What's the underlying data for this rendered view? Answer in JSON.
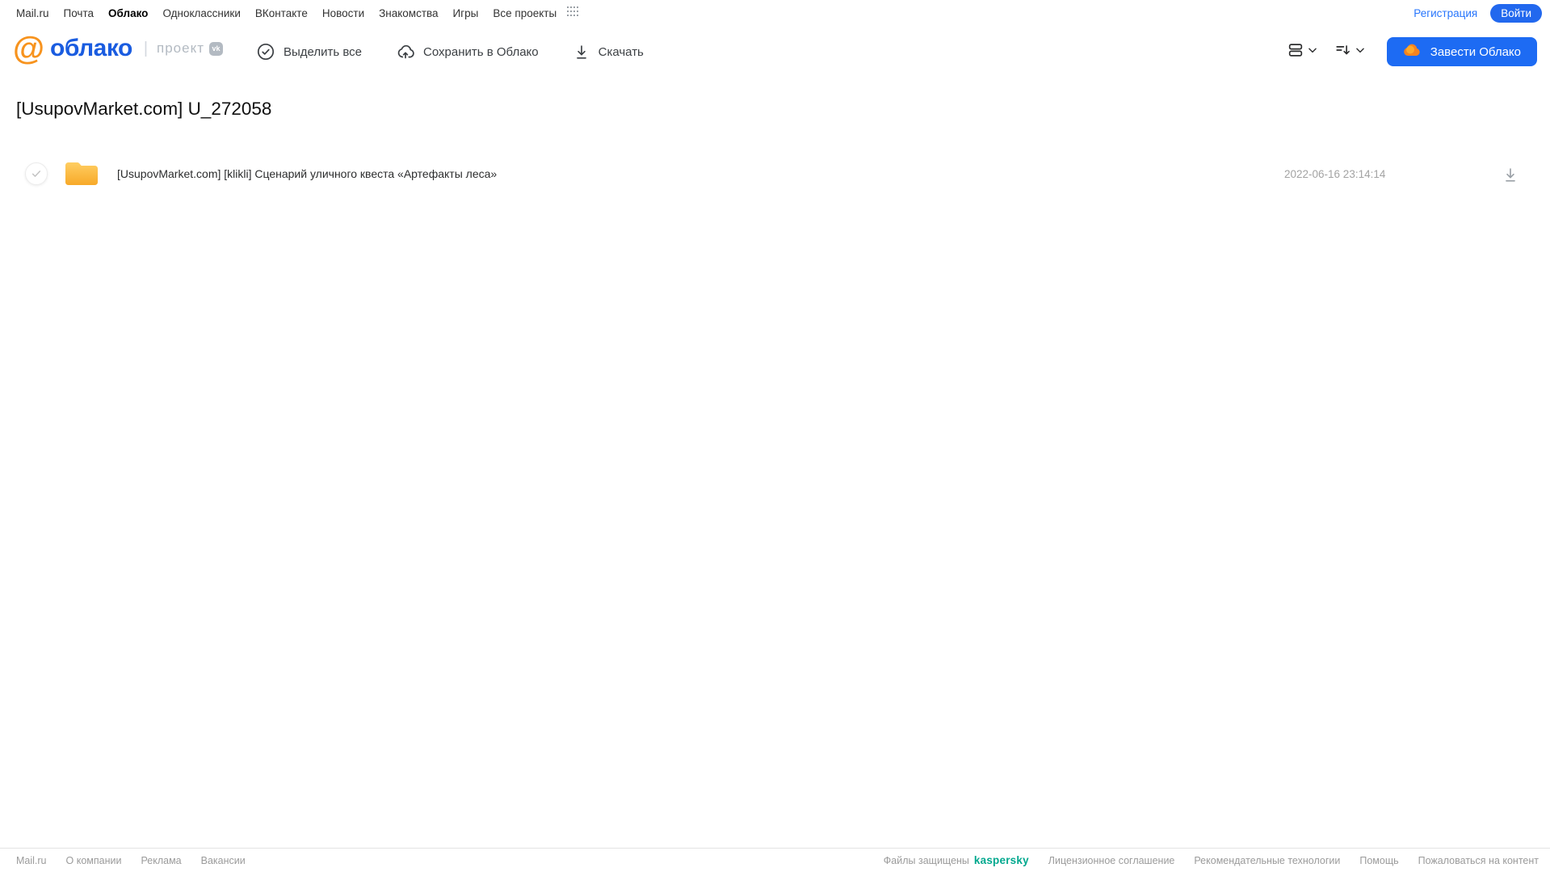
{
  "topnav": {
    "items": [
      "Mail.ru",
      "Почта",
      "Облако",
      "Одноклассники",
      "ВКонтакте",
      "Новости",
      "Знакомства",
      "Игры",
      "Все проекты"
    ],
    "registration": "Регистрация",
    "login": "Войти"
  },
  "brand": {
    "name": "облако",
    "at_sign": "@",
    "divider": "|",
    "project": "проект",
    "vk": "vk"
  },
  "toolbar": {
    "select_all": "Выделить все",
    "save_to_cloud": "Сохранить в Облако",
    "download": "Скачать"
  },
  "controls": {
    "get_cloud": "Завести Облако"
  },
  "page": {
    "title": "[UsupovMarket.com] U_272058"
  },
  "files": [
    {
      "type": "folder",
      "name": "[UsupovMarket.com] [klikli] Сценарий уличного квеста «Артефакты леса»",
      "date": "2022-06-16 23:14:14"
    }
  ],
  "footer": {
    "links_left": [
      "Mail.ru",
      "О компании",
      "Реклама",
      "Вакансии"
    ],
    "protected_by": "Файлы защищены",
    "kaspersky": "kaspersky",
    "links_right": [
      "Лицензионное соглашение",
      "Рекомендательные технологии",
      "Помощь",
      "Пожаловаться на контент"
    ]
  },
  "colors": {
    "accent_blue": "#1d6bf3",
    "link_blue": "#2775fc",
    "logo_blue": "#1a5ce0",
    "logo_orange": "#f7931e",
    "folder_yellow": "#fbbc3c",
    "kaspersky_teal": "#00a88e",
    "muted_gray": "#9b9b9b"
  }
}
